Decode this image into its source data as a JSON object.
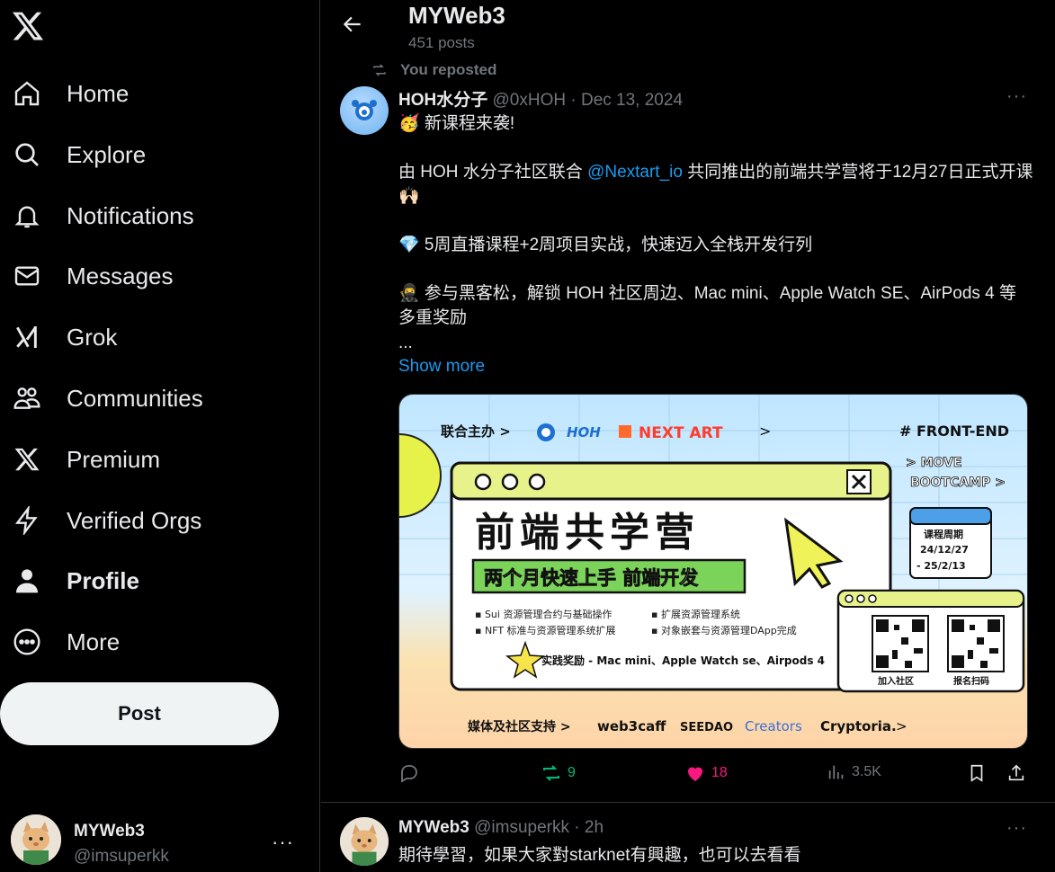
{
  "nav": {
    "items": [
      {
        "label": "Home",
        "icon": "home-icon"
      },
      {
        "label": "Explore",
        "icon": "search-icon"
      },
      {
        "label": "Notifications",
        "icon": "bell-icon"
      },
      {
        "label": "Messages",
        "icon": "envelope-icon"
      },
      {
        "label": "Grok",
        "icon": "grok-icon"
      },
      {
        "label": "Communities",
        "icon": "people-icon"
      },
      {
        "label": "Premium",
        "icon": "x-logo-icon"
      },
      {
        "label": "Verified Orgs",
        "icon": "lightning-icon"
      },
      {
        "label": "Profile",
        "icon": "person-icon"
      },
      {
        "label": "More",
        "icon": "more-circle-icon"
      }
    ],
    "post_label": "Post"
  },
  "account": {
    "name": "MYWeb3",
    "handle": "@imsuperkk",
    "more": "···"
  },
  "header": {
    "title": "MYWeb3",
    "subtitle": "451 posts"
  },
  "post1": {
    "repost_label": "You reposted",
    "author": "HOH水分子",
    "handle": "@0xHOH",
    "separator": "·",
    "date": "Dec 13, 2024",
    "line1": "🥳 新课程来袭!",
    "line2a": "由 HOH 水分子社区联合 ",
    "mention": "@Nextart_io",
    "line2b": " 共同推出的前端共学营将于12月27日正式开课 🙌🏻",
    "line3": "💎 5周直播课程+2周项目实战，快速迈入全栈开发行列",
    "line4": "🥷 参与黑客松，解锁 HOH 社区周边、Mac mini、Apple Watch SE、AirPods 4 等多重奖励",
    "ellipsis": "...",
    "show_more": "Show more",
    "replies": "",
    "reposts": "9",
    "likes": "18",
    "views": "3.5K"
  },
  "banner": {
    "host_label": "联合主办 >",
    "hoh": "HOH",
    "nextart": "NEXT ART",
    "arrow": ">",
    "tag": "# FRONT-END",
    "move": "> MOVE",
    "bootcamp": "BOOTCAMP >",
    "title": "前端共学营",
    "subtitle": "两个月快速上手 前端开发",
    "b1": "▪ Sui 资源管理合约与基础操作",
    "b2": "▪ 扩展资源管理系统",
    "b3": "▪ NFT 标准与资源管理系统扩展",
    "b4": "▪ 对象嵌套与资源管理DApp完成",
    "reward": "实践奖励 - Mac mini、Apple Watch se、Airpods 4",
    "cal_title": "课程周期",
    "cal_start": "24/12/27",
    "cal_end": "- 25/2/13",
    "qr1": "加入社区",
    "qr2": "报名扫码",
    "support": "媒体及社区支持 >",
    "s1": "web3caff",
    "s2": "SEEDAO",
    "s3": "Creators",
    "s4": "Cryptoria.",
    "s5": ">"
  },
  "post2": {
    "author": "MYWeb3",
    "handle": "@imsuperkk",
    "separator": "·",
    "time": "2h",
    "text": "期待學習，如果大家對starknet有興趣，也可以去看看"
  },
  "colors": {
    "accent": "#1d9bf0",
    "like": "#f91880",
    "repost": "#00ba7c",
    "muted": "#71767b"
  }
}
